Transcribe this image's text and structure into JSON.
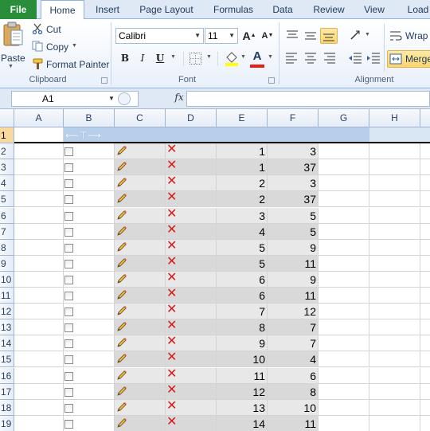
{
  "tabs": {
    "file": "File",
    "items": [
      "Home",
      "Insert",
      "Page Layout",
      "Formulas",
      "Data",
      "Review",
      "View",
      "Load"
    ]
  },
  "clipboard": {
    "paste": "Paste",
    "cut": "Cut",
    "copy": "Copy",
    "format_painter": "Format Painter",
    "label": "Clipboard"
  },
  "font": {
    "name": "Calibri",
    "size": "11",
    "grow": "A",
    "shrink": "A",
    "bold": "B",
    "italic": "I",
    "underline": "U",
    "font_color": "A",
    "label": "Font"
  },
  "alignment": {
    "wrap": "Wrap",
    "merge": "Merge",
    "label": "Alignment"
  },
  "formula_bar": {
    "name_box": "A1",
    "fx": "fx",
    "value": ""
  },
  "columns": [
    "A",
    "B",
    "C",
    "D",
    "E",
    "F",
    "G",
    "H"
  ],
  "rows": [
    {
      "num": "1"
    },
    {
      "num": "2",
      "e": "1",
      "f": "3"
    },
    {
      "num": "3",
      "e": "1",
      "f": "37"
    },
    {
      "num": "4",
      "e": "2",
      "f": "3"
    },
    {
      "num": "5",
      "e": "2",
      "f": "37"
    },
    {
      "num": "6",
      "e": "3",
      "f": "5"
    },
    {
      "num": "7",
      "e": "4",
      "f": "5"
    },
    {
      "num": "8",
      "e": "5",
      "f": "9"
    },
    {
      "num": "9",
      "e": "5",
      "f": "11"
    },
    {
      "num": "10",
      "e": "6",
      "f": "9"
    },
    {
      "num": "11",
      "e": "6",
      "f": "11"
    },
    {
      "num": "12",
      "e": "7",
      "f": "12"
    },
    {
      "num": "13",
      "e": "8",
      "f": "7"
    },
    {
      "num": "14",
      "e": "9",
      "f": "7"
    },
    {
      "num": "15",
      "e": "10",
      "f": "4"
    },
    {
      "num": "16",
      "e": "11",
      "f": "6"
    },
    {
      "num": "17",
      "e": "12",
      "f": "8"
    },
    {
      "num": "18",
      "e": "13",
      "f": "10"
    },
    {
      "num": "19",
      "e": "14",
      "f": "11"
    }
  ],
  "colors": {
    "file_tab": "#2a8d3a",
    "header_band": "#b8cfeb",
    "row_band_a": "#e8e8e8",
    "row_band_b": "#d9d9d9",
    "delete_icon": "#d81a1a"
  }
}
